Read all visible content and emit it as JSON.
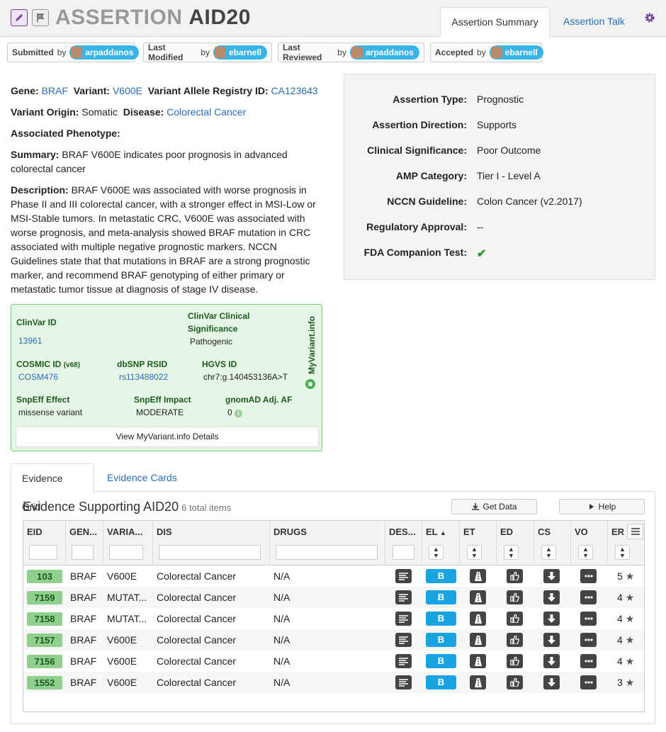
{
  "header": {
    "title_prefix": "ASSERTION",
    "title_id": "AID20",
    "tabs": [
      "Assertion Summary",
      "Assertion Talk"
    ]
  },
  "actors": [
    {
      "label": "Submitted",
      "by": "by",
      "user": "arpaddanos"
    },
    {
      "label": "Last Modified",
      "by": "by",
      "user": "ebarnell"
    },
    {
      "label": "Last Reviewed",
      "by": "by",
      "user": "arpaddanos"
    },
    {
      "label": "Accepted",
      "by": "by",
      "user": "ebarnell"
    }
  ],
  "summary": {
    "gene_label": "Gene:",
    "gene": "BRAF",
    "variant_label": "Variant:",
    "variant": "V600E",
    "registry_label": "Variant Allele Registry ID:",
    "registry": "CA123643",
    "origin_label": "Variant Origin:",
    "origin": "Somatic",
    "disease_label": "Disease:",
    "disease": "Colorectal Cancer",
    "phenotype_label": "Associated Phenotype:",
    "summary_label": "Summary:",
    "summary": "BRAF V600E indicates poor prognosis in advanced colorectal cancer",
    "description_label": "Description:",
    "description": "BRAF V600E was associated with worse prognosis in Phase II and III colorectal cancer, with a stronger effect in MSI-Low or MSI-Stable tumors. In metastatic CRC, V600E was associated with worse prognosis, and meta-analysis showed BRAF mutation in CRC associated with multiple negative prognostic markers. NCCN Guidelines state that that mutations in BRAF are a strong prognostic marker, and recommend BRAF genotyping of either primary or metastatic tumor tissue at diagnosis of stage IV disease."
  },
  "details": [
    {
      "key": "Assertion Type:",
      "value": "Prognostic"
    },
    {
      "key": "Assertion Direction:",
      "value": "Supports"
    },
    {
      "key": "Clinical Significance:",
      "value": "Poor Outcome"
    },
    {
      "key": "AMP Category:",
      "value": "Tier I - Level A"
    },
    {
      "key": "NCCN Guideline:",
      "value": "Colon Cancer (v2.2017)"
    },
    {
      "key": "Regulatory Approval:",
      "value": "--"
    },
    {
      "key": "FDA Companion Test:",
      "value": "✔"
    }
  ],
  "myvariant": {
    "clinvar_id_label": "ClinVar ID",
    "clinvar_id": "13961",
    "clinvar_sig_label": "ClinVar Clinical Significance",
    "clinvar_sig": "Pathogenic",
    "cosmic_label": "COSMIC ID",
    "cosmic_ver": "(v68)",
    "cosmic": "COSM476",
    "dbsnp_label": "dbSNP RSID",
    "dbsnp": "rs113488022",
    "hgvs_label": "HGVS ID",
    "hgvs": "chr7:g.140453136A>T",
    "snpeff_effect_label": "SnpEff Effect",
    "snpeff_effect": "missense variant",
    "snpeff_impact_label": "SnpEff Impact",
    "snpeff_impact": "MODERATE",
    "gnomad_label": "gnomAD Adj. AF",
    "gnomad": "0",
    "brand": "MyVariant.info",
    "button": "View MyVariant.info Details"
  },
  "evidence": {
    "tabs": [
      "Evidence Grid",
      "Evidence Cards"
    ],
    "title": "Evidence Supporting AID20",
    "count": "6 total items",
    "get_data": "Get Data",
    "help": "Help",
    "columns": [
      "EID",
      "GEN...",
      "VARIA...",
      "DIS",
      "DRUGS",
      "DES...",
      "EL",
      "ET",
      "ED",
      "CS",
      "VO",
      "ER"
    ],
    "rows": [
      {
        "eid": "103",
        "gene": "BRAF",
        "variant": "V600E",
        "disease": "Colorectal Cancer",
        "drugs": "N/A",
        "el": "B",
        "er": "5"
      },
      {
        "eid": "7159",
        "gene": "BRAF",
        "variant": "MUTAT...",
        "disease": "Colorectal Cancer",
        "drugs": "N/A",
        "el": "B",
        "er": "4"
      },
      {
        "eid": "7158",
        "gene": "BRAF",
        "variant": "MUTAT...",
        "disease": "Colorectal Cancer",
        "drugs": "N/A",
        "el": "B",
        "er": "4"
      },
      {
        "eid": "7157",
        "gene": "BRAF",
        "variant": "V600E",
        "disease": "Colorectal Cancer",
        "drugs": "N/A",
        "el": "B",
        "er": "4"
      },
      {
        "eid": "7156",
        "gene": "BRAF",
        "variant": "V600E",
        "disease": "Colorectal Cancer",
        "drugs": "N/A",
        "el": "B",
        "er": "4"
      },
      {
        "eid": "1552",
        "gene": "BRAF",
        "variant": "V600E",
        "disease": "Colorectal Cancer",
        "drugs": "N/A",
        "el": "B",
        "er": "3"
      }
    ]
  },
  "colors": {
    "accent": "#2a6ebb",
    "user_badge": "#39b4e6",
    "eid_badge": "#90d08d",
    "evidence_level": "#1aa3e2"
  }
}
